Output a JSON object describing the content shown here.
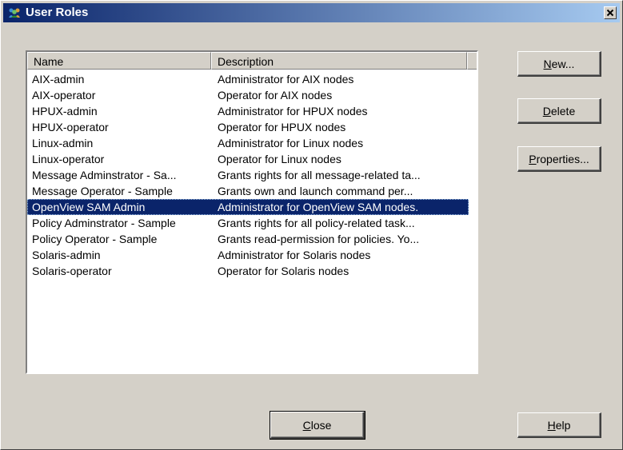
{
  "window": {
    "title": "User Roles",
    "icon": "users-roles-icon",
    "close_glyph": "×"
  },
  "list": {
    "headers": {
      "name": "Name",
      "description": "Description"
    },
    "selected_index": 8,
    "rows": [
      {
        "name": "AIX-admin",
        "description": "Administrator for AIX nodes"
      },
      {
        "name": "AIX-operator",
        "description": "Operator for AIX nodes"
      },
      {
        "name": "HPUX-admin",
        "description": "Administrator for HPUX nodes"
      },
      {
        "name": "HPUX-operator",
        "description": "Operator for HPUX nodes"
      },
      {
        "name": "Linux-admin",
        "description": "Administrator for Linux nodes"
      },
      {
        "name": "Linux-operator",
        "description": "Operator for Linux nodes"
      },
      {
        "name": "Message Adminstrator - Sa...",
        "description": "Grants rights for all message-related ta..."
      },
      {
        "name": "Message Operator - Sample",
        "description": "Grants own and launch command per..."
      },
      {
        "name": "OpenView SAM Admin",
        "description": "Administrator for OpenView SAM nodes."
      },
      {
        "name": "Policy Adminstrator - Sample",
        "description": "Grants rights for all policy-related task..."
      },
      {
        "name": "Policy Operator - Sample",
        "description": "Grants read-permission for policies. Yo..."
      },
      {
        "name": "Solaris-admin",
        "description": "Administrator for Solaris nodes"
      },
      {
        "name": "Solaris-operator",
        "description": "Operator for Solaris nodes"
      }
    ]
  },
  "buttons": {
    "new": {
      "mnemonic": "N",
      "rest": "ew..."
    },
    "delete": {
      "mnemonic": "D",
      "rest": "elete"
    },
    "properties": {
      "mnemonic": "P",
      "rest": "roperties..."
    },
    "close": {
      "mnemonic": "C",
      "rest": "lose"
    },
    "help": {
      "mnemonic": "H",
      "rest": "elp"
    }
  },
  "colors": {
    "face": "#d4d0c8",
    "titlebar_start": "#0a246a",
    "titlebar_end": "#a6caf0",
    "selection": "#0a246a"
  }
}
